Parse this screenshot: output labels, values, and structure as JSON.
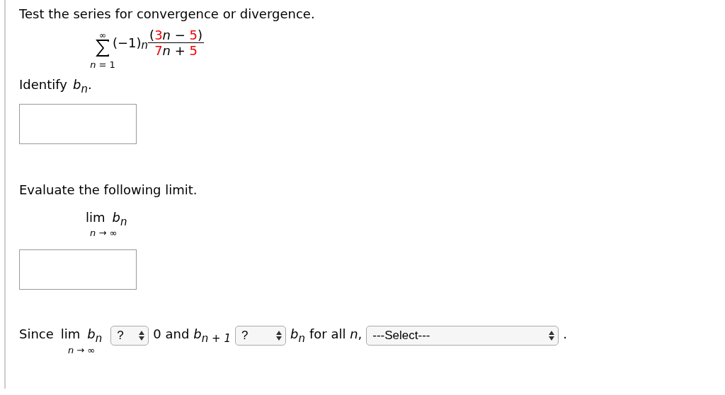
{
  "prompt": "Test the series for convergence or divergence.",
  "series": {
    "upper": "∞",
    "lower": "*n* = 1",
    "factor": "(−1)",
    "exponent": "n",
    "numerator": [
      {
        "text": "(",
        "highlight": false
      },
      {
        "text": "3",
        "highlight": true
      },
      {
        "text": "*n* − ",
        "highlight": false
      },
      {
        "text": "5",
        "highlight": true
      },
      {
        "text": ")",
        "highlight": false
      }
    ],
    "denominator": [
      {
        "text": "7",
        "highlight": true
      },
      {
        "text": "*n* + ",
        "highlight": false
      },
      {
        "text": "5",
        "highlight": true
      }
    ]
  },
  "part1": {
    "label": "Identify",
    "symbol": "*b*$_{n}$."
  },
  "part2": {
    "label": "Evaluate the following limit.",
    "lim": "lim",
    "lim_under": "*n* → ∞",
    "expr": "*b*$_{n}$"
  },
  "conclusion": [
    {
      "kind": "text",
      "text": "Since"
    },
    {
      "kind": "limit",
      "lim": "lim",
      "under": "*n* → ∞",
      "expr": "*b*$_{n}$"
    },
    {
      "kind": "select",
      "value": "?"
    },
    {
      "kind": "text",
      "text": "0 and"
    },
    {
      "kind": "math",
      "text": "*b*$_{n + 1}$"
    },
    {
      "kind": "select",
      "value": "?"
    },
    {
      "kind": "math",
      "text": "*b*$_{n}$"
    },
    {
      "kind": "text",
      "text": "for all *n*,"
    },
    {
      "kind": "select",
      "value": "---Select---"
    },
    {
      "kind": "text",
      "text": "."
    }
  ]
}
